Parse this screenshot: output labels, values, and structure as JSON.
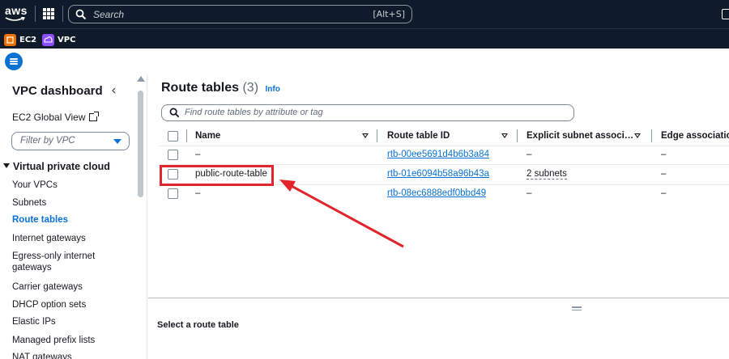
{
  "topnav": {
    "logo_text": "aws",
    "search_placeholder": "Search",
    "search_shortcut": "[Alt+S]"
  },
  "favorites": [
    {
      "label": "EC2",
      "icon": "ec2-icon",
      "color": "#ed7100"
    },
    {
      "label": "VPC",
      "icon": "vpc-icon",
      "color": "#8c4fff"
    }
  ],
  "sidebar": {
    "title": "VPC dashboard",
    "ec2_global_view": "EC2 Global View",
    "filter_placeholder": "Filter by VPC",
    "section_title": "Virtual private cloud",
    "items": [
      {
        "label": "Your VPCs",
        "active": false
      },
      {
        "label": "Subnets",
        "active": false
      },
      {
        "label": "Route tables",
        "active": true
      },
      {
        "label": "Internet gateways",
        "active": false
      },
      {
        "label": "Egress-only internet gateways",
        "active": false
      },
      {
        "label": "Carrier gateways",
        "active": false
      },
      {
        "label": "DHCP option sets",
        "active": false
      },
      {
        "label": "Elastic IPs",
        "active": false
      },
      {
        "label": "Managed prefix lists",
        "active": false
      },
      {
        "label": "NAT gateways",
        "active": false
      }
    ]
  },
  "main": {
    "title": "Route tables",
    "count": "(3)",
    "info_label": "Info",
    "filter_placeholder": "Find route tables by attribute or tag",
    "columns": [
      "Name",
      "Route table ID",
      "Explicit subnet associ…",
      "Edge association"
    ],
    "rows": [
      {
        "name": "–",
        "route_table_id": "rtb-00ee5691d4b6b3a84",
        "explicit_subnet": "–",
        "edge": "–"
      },
      {
        "name": "public-route-table",
        "route_table_id": "rtb-01e6094b58a96b43a",
        "explicit_subnet": "2 subnets",
        "edge": "–"
      },
      {
        "name": "–",
        "route_table_id": "rtb-08ec6888edf0bbd49",
        "explicit_subnet": "–",
        "edge": "–"
      }
    ],
    "split_panel_title": "Select a route table"
  },
  "colors": {
    "nav_bg": "#0f1b2a",
    "link": "#0972d3",
    "annotation": "#e1252b"
  }
}
